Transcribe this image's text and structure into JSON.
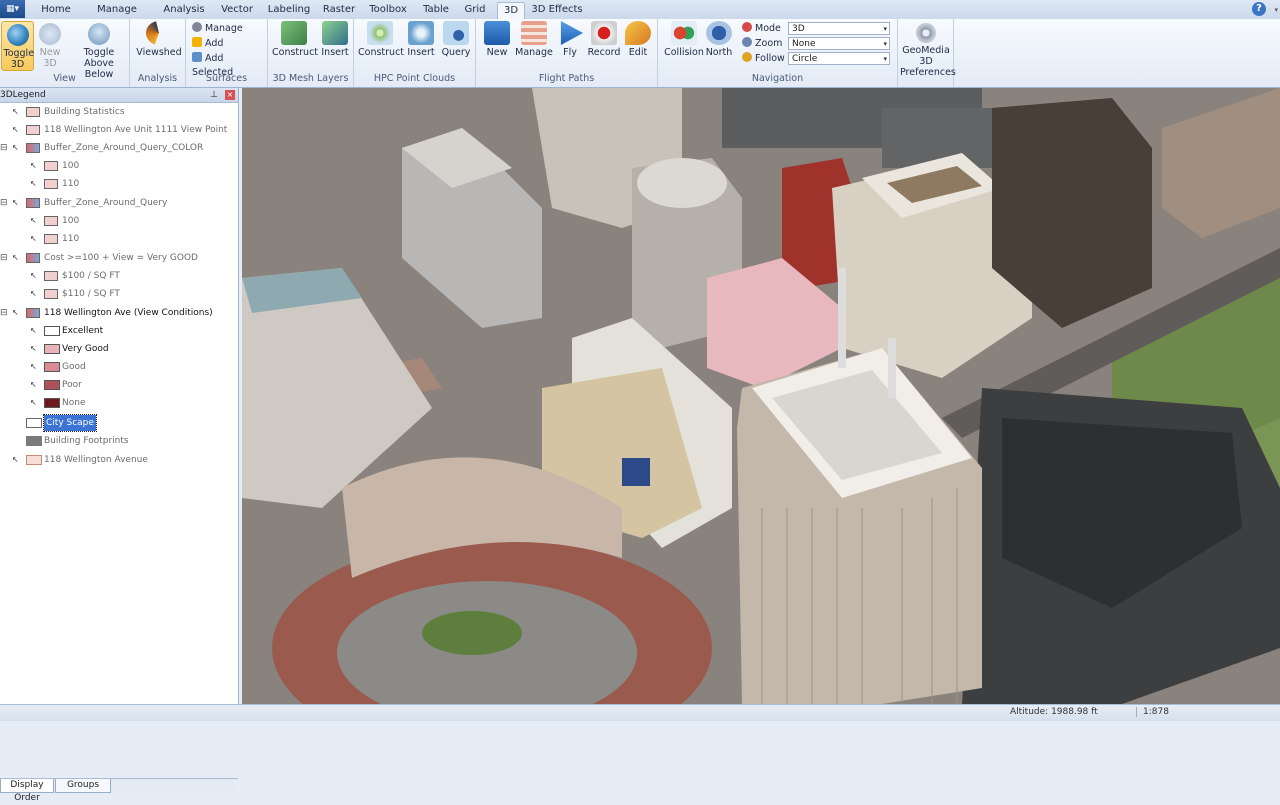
{
  "app_menu_label": "▦▾",
  "tabs": [
    "Home",
    "Manage Data",
    "Analysis",
    "Vector",
    "Labeling",
    "Raster",
    "Toolbox",
    "Table",
    "Grid",
    "3D",
    "3D Effects"
  ],
  "active_tab": "3D",
  "ribbon": {
    "view": {
      "label": "View",
      "toggle_3d": "Toggle 3D",
      "new_3d": "New 3D",
      "toggle_above": "Toggle Above Below"
    },
    "analysis": {
      "label": "Analysis",
      "viewshed": "Viewshed"
    },
    "surfaces": {
      "label": "Surfaces",
      "manage": "Manage",
      "add": "Add",
      "add_selected": "Add Selected"
    },
    "mesh": {
      "label": "3D Mesh Layers",
      "construct": "Construct",
      "insert": "Insert"
    },
    "hpc": {
      "label": "HPC Point Clouds",
      "construct": "Construct",
      "insert": "Insert",
      "query": "Query"
    },
    "flight": {
      "label": "Flight Paths",
      "new": "New",
      "manage": "Manage",
      "fly": "Fly",
      "record": "Record",
      "edit": "Edit"
    },
    "navigation": {
      "label": "Navigation",
      "collision": "Collision",
      "north": "North",
      "mode_label": "Mode",
      "mode_value": "3D",
      "zoom_label": "Zoom",
      "zoom_value": "None",
      "follow_label": "Follow",
      "follow_value": "Circle"
    },
    "prefs": {
      "label": "GeoMedia 3D Preferences",
      "line1": "GeoMedia",
      "line2": "3D",
      "line3": "Preferences"
    }
  },
  "legend": {
    "title": "3DLegend",
    "items": [
      {
        "text": "Building Statistics"
      },
      {
        "text": "118 Wellington Ave Unit 1111 View Point"
      },
      {
        "text": "Buffer_Zone_Around_Query_COLOR"
      },
      {
        "text": "100"
      },
      {
        "text": "110"
      },
      {
        "text": "Buffer_Zone_Around_Query"
      },
      {
        "text": "100"
      },
      {
        "text": "110"
      },
      {
        "text": "Cost >=100 + View = Very GOOD"
      },
      {
        "text": "$100 / SQ FT"
      },
      {
        "text": "$110 / SQ FT"
      },
      {
        "text": "118 Wellington Ave (View Conditions)"
      },
      {
        "text": "Excellent"
      },
      {
        "text": "Very Good"
      },
      {
        "text": "Good"
      },
      {
        "text": "Poor"
      },
      {
        "text": "None"
      },
      {
        "text": "City Scape"
      },
      {
        "text": "Building Footprints"
      },
      {
        "text": "118 Wellington Avenue"
      }
    ],
    "view_condition_colors": {
      "Excellent": "#ffffff",
      "Very Good": "#e8b4b8",
      "Good": "#d98c94",
      "Poor": "#b0505a",
      "None": "#6e1a20"
    },
    "tabs": [
      "Display Order",
      "Groups"
    ]
  },
  "status": {
    "altitude": "Altitude: 1988.98 ft",
    "scale": "1:878"
  }
}
